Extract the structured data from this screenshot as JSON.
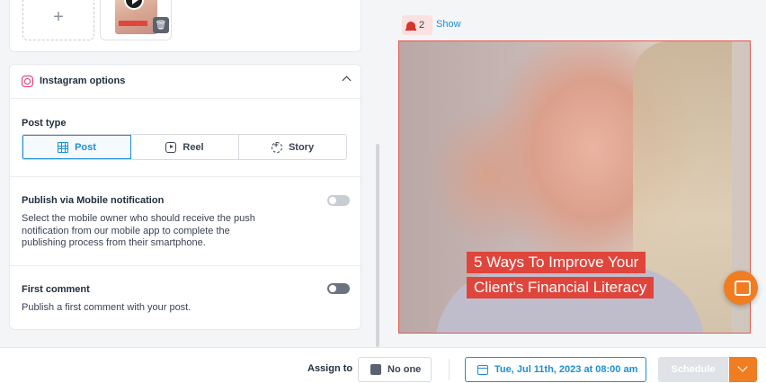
{
  "media": {
    "add_label": "+",
    "thumbnail_icons": [
      "play-icon",
      "trash-icon"
    ]
  },
  "instagram": {
    "title": "Instagram options",
    "post_type_label": "Post type",
    "post_types": [
      {
        "label": "Post",
        "icon": "grid-icon",
        "active": true
      },
      {
        "label": "Reel",
        "icon": "reel-icon",
        "active": false
      },
      {
        "label": "Story",
        "icon": "story-icon",
        "active": false
      }
    ],
    "mobile_notification": {
      "title": "Publish via Mobile notification",
      "description": "Select the mobile owner who should receive the push notification from our mobile app to complete the publishing process from their smartphone.",
      "enabled": false
    },
    "first_comment": {
      "title": "First comment",
      "description": "Publish a first comment with your post.",
      "enabled": false
    }
  },
  "preview": {
    "alerts_count": "2",
    "show_label": "Show",
    "caption_line1": "5 Ways To Improve Your",
    "caption_line2": "Client's Financial Literacy"
  },
  "footer": {
    "assign_label": "Assign to",
    "assignee": "No one",
    "date": "Tue, Jul 11th, 2023 at 08:00 am",
    "schedule_label": "Schedule"
  },
  "colors": {
    "accent": "#1d8fd6",
    "brand_orange": "#f07d22",
    "instagram": "#e1306c",
    "caption_red": "#e0453c"
  }
}
